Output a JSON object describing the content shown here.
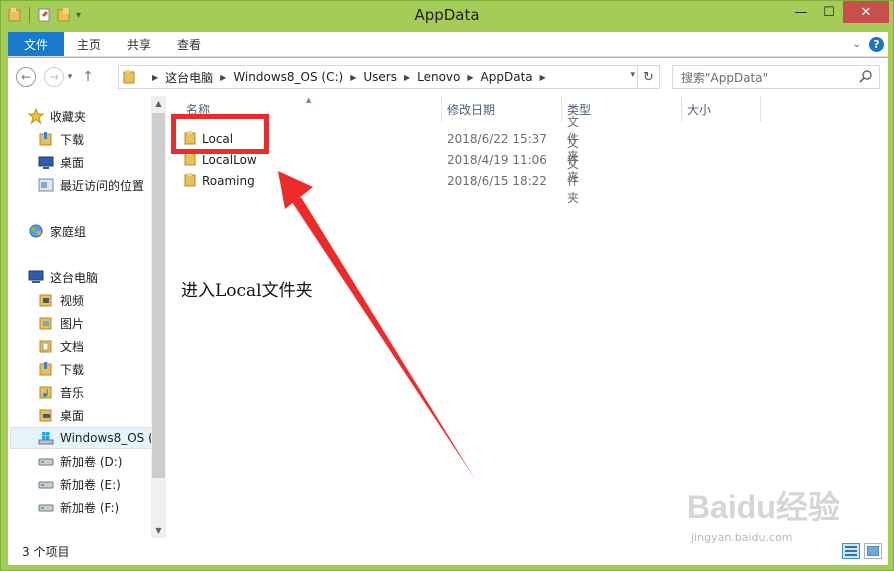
{
  "window": {
    "title": "AppData"
  },
  "ribbon": {
    "tabs": [
      {
        "label": "文件",
        "active": true
      },
      {
        "label": "主页",
        "active": false
      },
      {
        "label": "共享",
        "active": false
      },
      {
        "label": "查看",
        "active": false
      }
    ],
    "help_label": "?"
  },
  "address": {
    "crumbs": [
      "这台电脑",
      "Windows8_OS (C:)",
      "Users",
      "Lenovo",
      "AppData"
    ]
  },
  "search": {
    "placeholder": "搜索\"AppData\""
  },
  "sidebar": {
    "items": [
      {
        "label": "收藏夹",
        "icon": "star-icon"
      },
      {
        "label": "下载",
        "icon": "downloads-folder-icon"
      },
      {
        "label": "桌面",
        "icon": "desktop-icon"
      },
      {
        "label": "最近访问的位置",
        "icon": "recent-places-icon"
      },
      {
        "label": "家庭组",
        "icon": "homegroup-icon"
      },
      {
        "label": "这台电脑",
        "icon": "computer-icon"
      },
      {
        "label": "视频",
        "icon": "videos-folder-icon"
      },
      {
        "label": "图片",
        "icon": "pictures-folder-icon"
      },
      {
        "label": "文档",
        "icon": "documents-folder-icon"
      },
      {
        "label": "下载",
        "icon": "downloads-folder-icon"
      },
      {
        "label": "音乐",
        "icon": "music-folder-icon"
      },
      {
        "label": "桌面",
        "icon": "desktop-folder-icon"
      },
      {
        "label": "Windows8_OS (",
        "icon": "windows-drive-icon"
      },
      {
        "label": "新加卷 (D:)",
        "icon": "drive-icon"
      },
      {
        "label": "新加卷 (E:)",
        "icon": "drive-icon"
      },
      {
        "label": "新加卷 (F:)",
        "icon": "drive-icon"
      }
    ]
  },
  "filelist": {
    "columns": [
      "名称",
      "修改日期",
      "类型",
      "大小"
    ],
    "rows": [
      {
        "name": "Local",
        "date": "2018/6/22 15:37",
        "type": "文件夹"
      },
      {
        "name": "LocalLow",
        "date": "2018/4/19 11:06",
        "type": "文件夹"
      },
      {
        "name": "Roaming",
        "date": "2018/6/15 18:22",
        "type": "文件夹"
      }
    ]
  },
  "annotation": {
    "text": "进入Local文件夹"
  },
  "status": {
    "count": "3 个项目"
  },
  "watermark": {
    "text": "jingyan.baidu.com",
    "logo": "Baidu经验"
  },
  "colors": {
    "frame": "#a4cc57",
    "file_tab": "#1979ca",
    "highlight": "#ee2b2b",
    "close": "#c7504a"
  }
}
